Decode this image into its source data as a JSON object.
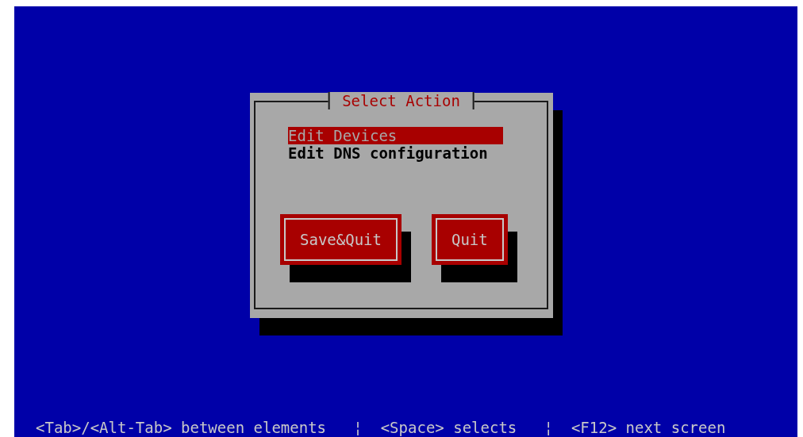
{
  "dialog": {
    "title": "Select Action",
    "items": [
      {
        "label": "Edit Devices",
        "selected": true
      },
      {
        "label": "Edit DNS configuration",
        "selected": false
      }
    ],
    "buttons": [
      {
        "label": "Save&Quit"
      },
      {
        "label": "Quit"
      }
    ]
  },
  "help_line": "<Tab>/<Alt-Tab> between elements   ¦  <Space> selects   ¦  <F12> next screen"
}
